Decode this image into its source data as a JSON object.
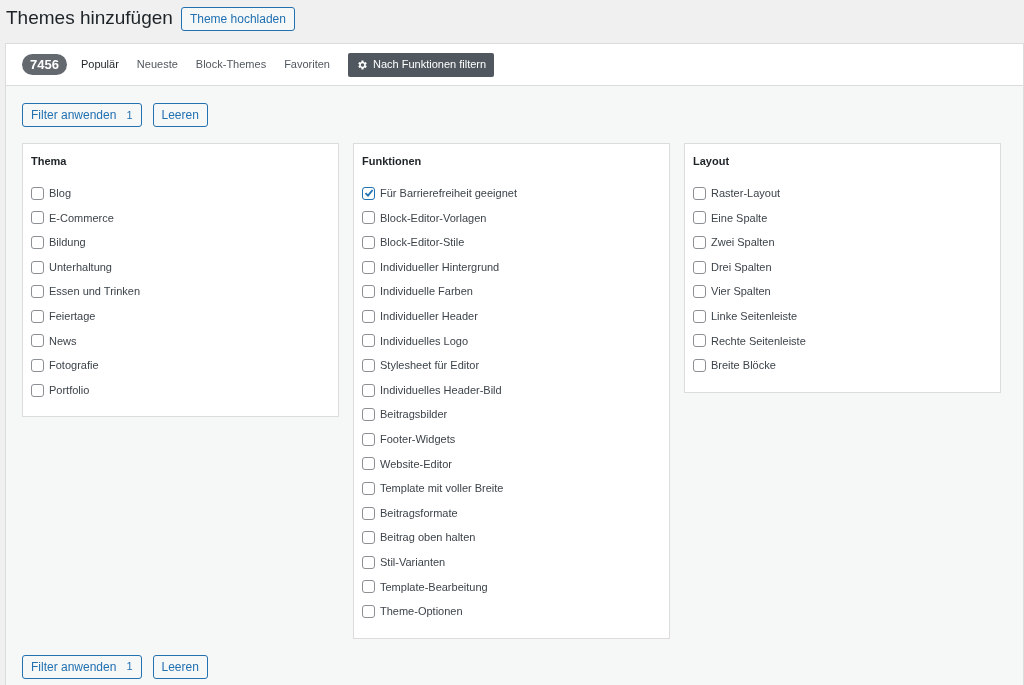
{
  "page": {
    "title": "Themes hinzufügen",
    "upload_button": "Theme hochladen"
  },
  "nav": {
    "count": "7456",
    "tabs": [
      {
        "label": "Populär",
        "selected": true
      },
      {
        "label": "Neueste",
        "selected": false
      },
      {
        "label": "Block-Themes",
        "selected": false
      },
      {
        "label": "Favoriten",
        "selected": false
      }
    ],
    "filter_button": {
      "label": "Nach Funktionen filtern",
      "active": true
    }
  },
  "top_actions": {
    "apply": {
      "label": "Filter anwenden",
      "count": "1"
    },
    "clear": "Leeren"
  },
  "groups": [
    {
      "title": "Thema",
      "options": [
        {
          "label": "Blog",
          "checked": false
        },
        {
          "label": "E-Commerce",
          "checked": false
        },
        {
          "label": "Bildung",
          "checked": false
        },
        {
          "label": "Unterhaltung",
          "checked": false
        },
        {
          "label": "Essen und Trinken",
          "checked": false
        },
        {
          "label": "Feiertage",
          "checked": false
        },
        {
          "label": "News",
          "checked": false
        },
        {
          "label": "Fotografie",
          "checked": false
        },
        {
          "label": "Portfolio",
          "checked": false
        }
      ]
    },
    {
      "title": "Funktionen",
      "options": [
        {
          "label": "Für Barrierefreiheit geeignet",
          "checked": true
        },
        {
          "label": "Block-Editor-Vorlagen",
          "checked": false
        },
        {
          "label": "Block-Editor-Stile",
          "checked": false
        },
        {
          "label": "Individueller Hintergrund",
          "checked": false
        },
        {
          "label": "Individuelle Farben",
          "checked": false
        },
        {
          "label": "Individueller Header",
          "checked": false
        },
        {
          "label": "Individuelles Logo",
          "checked": false
        },
        {
          "label": "Stylesheet für Editor",
          "checked": false
        },
        {
          "label": "Individuelles Header-Bild",
          "checked": false
        },
        {
          "label": "Beitragsbilder",
          "checked": false
        },
        {
          "label": "Footer-Widgets",
          "checked": false
        },
        {
          "label": "Website-Editor",
          "checked": false
        },
        {
          "label": "Template mit voller Breite",
          "checked": false
        },
        {
          "label": "Beitragsformate",
          "checked": false
        },
        {
          "label": "Beitrag oben halten",
          "checked": false
        },
        {
          "label": "Stil-Varianten",
          "checked": false
        },
        {
          "label": "Template-Bearbeitung",
          "checked": false
        },
        {
          "label": "Theme-Optionen",
          "checked": false
        }
      ]
    },
    {
      "title": "Layout",
      "options": [
        {
          "label": "Raster-Layout",
          "checked": false
        },
        {
          "label": "Eine Spalte",
          "checked": false
        },
        {
          "label": "Zwei Spalten",
          "checked": false
        },
        {
          "label": "Drei Spalten",
          "checked": false
        },
        {
          "label": "Vier Spalten",
          "checked": false
        },
        {
          "label": "Linke Seitenleiste",
          "checked": false
        },
        {
          "label": "Rechte Seitenleiste",
          "checked": false
        },
        {
          "label": "Breite Blöcke",
          "checked": false
        }
      ]
    }
  ],
  "bottom_actions": {
    "apply": {
      "label": "Filter anwenden",
      "count": "1"
    },
    "clear": "Leeren"
  }
}
